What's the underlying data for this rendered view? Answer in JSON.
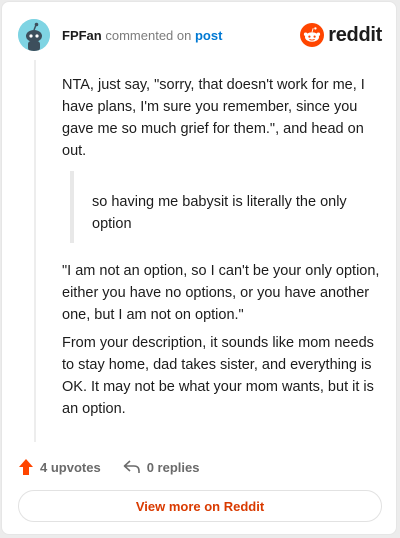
{
  "header": {
    "username": "FPFan",
    "commented_on": "commented on",
    "post_link": "post",
    "brand": "reddit"
  },
  "comment": {
    "paragraph1": "NTA, just say, \"sorry, that doesn't work for me, I have plans, I'm sure you remember, since you gave me so much grief for them.\", and head on out.",
    "quote": "so having me babysit is literally the only option",
    "paragraph2": "\"I am not an option, so I can't be your only option, either you have no options, or you have another one, but I am not on option.\"",
    "paragraph3": "From your description, it sounds like mom needs to stay home, dad takes sister, and everything is OK. It may not be what your mom wants, but it is an option."
  },
  "actions": {
    "upvotes": "4 upvotes",
    "replies": "0 replies",
    "upvote_icon": "upvote-arrow-icon",
    "reply_icon": "reply-arrow-icon"
  },
  "footer": {
    "view_more": "View more on Reddit"
  },
  "colors": {
    "brand_orange": "#ff4500",
    "link_blue": "#0079d3",
    "button_text": "#d93a00",
    "avatar_bg": "#7fd4e3"
  }
}
